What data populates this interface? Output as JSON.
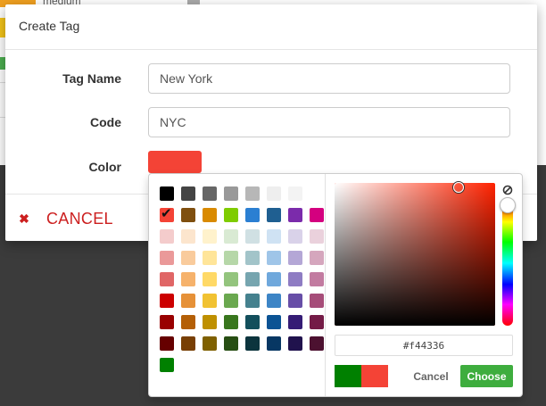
{
  "background": {
    "partial_label": "medium"
  },
  "dialog": {
    "title": "Create Tag",
    "fields": {
      "tag_name": {
        "label": "Tag Name",
        "value": "New York"
      },
      "code": {
        "label": "Code",
        "value": "NYC"
      },
      "color": {
        "label": "Color",
        "value": "#f44336"
      }
    },
    "cancel_label": "CANCEL",
    "cancel_icon": "close-icon"
  },
  "picker": {
    "palette": [
      "#000000",
      "#444444",
      "#666666",
      "#999999",
      "#b7b7b7",
      "#eeeeee",
      "#f3f3f3",
      "#f44336",
      "#7f4f0f",
      "#d98a00",
      "#7fcc00",
      "#2b7fd2",
      "#1f5f91",
      "#7b2bab",
      "#d4007f",
      "#f4cccc",
      "#fce5cd",
      "#fff2cc",
      "#d9ead3",
      "#d0e0e3",
      "#cfe2f3",
      "#d9d2e9",
      "#ead1dc",
      "#ea9999",
      "#f9cb9c",
      "#ffe599",
      "#b6d7a8",
      "#a2c4c9",
      "#9fc5e8",
      "#b4a7d6",
      "#d5a6bd",
      "#e06666",
      "#f6b26b",
      "#ffd966",
      "#93c47d",
      "#76a5af",
      "#6fa8dc",
      "#8e7cc3",
      "#c27ba0",
      "#cc0000",
      "#e69138",
      "#f1c232",
      "#6aa84f",
      "#45818e",
      "#3d85c6",
      "#674ea7",
      "#a64d79",
      "#990000",
      "#b45f06",
      "#bf9000",
      "#38761d",
      "#134f5c",
      "#0b5394",
      "#351c75",
      "#741b47",
      "#660000",
      "#783f04",
      "#7f6000",
      "#274e13",
      "#0c343d",
      "#073763",
      "#20124d",
      "#4c1130",
      "#008000"
    ],
    "selected_index": 7,
    "hue_color": "#ff2200",
    "hex_value": "#f44336",
    "previous_color": "#008000",
    "current_color": "#f44336",
    "cancel_label": "Cancel",
    "choose_label": "Choose",
    "accent_color": "#3ead3e"
  }
}
